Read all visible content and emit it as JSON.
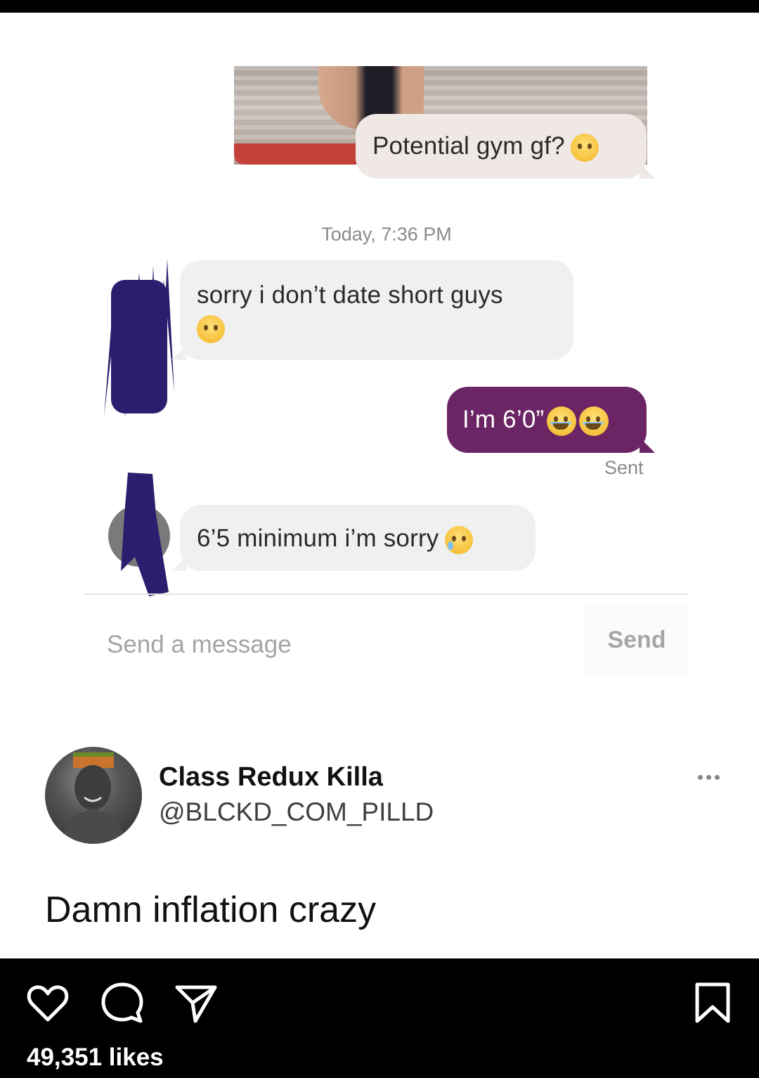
{
  "chat": {
    "gym_message": "Potential gym gf?",
    "timestamp": "Today, 7:36 PM",
    "reply_1": "sorry i don’t date short guys",
    "height_message": "I’m 6’0”",
    "sent_status": "Sent",
    "reply_2": "6’5 minimum i’m sorry",
    "input_placeholder": "Send a message",
    "send_label": "Send"
  },
  "tweet": {
    "author_name": "Class Redux Killa",
    "author_handle": "@BLCKD_COM_PILLD",
    "text": "Damn inflation crazy"
  },
  "post": {
    "likes": "49,351 likes"
  },
  "icons": {
    "thinking": "thinking-face-icon",
    "woozy": "woozy-face-icon",
    "sob": "loudly-crying-face-icon",
    "cry": "crying-face-icon",
    "more": "more-dots-icon",
    "like": "heart-icon",
    "comment": "comment-bubble-icon",
    "share": "paper-plane-icon",
    "save": "bookmark-icon"
  },
  "colors": {
    "sent_bubble": "#6b2464",
    "received_bubble": "#f0f0f1",
    "redaction": "#2a1f6e"
  }
}
